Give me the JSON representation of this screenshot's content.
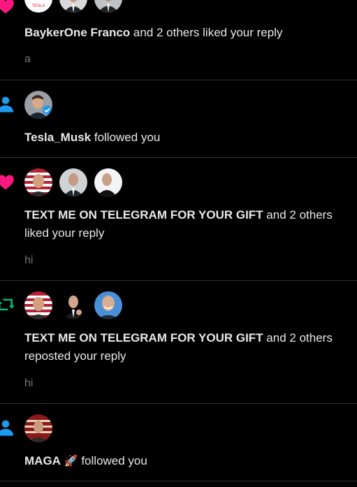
{
  "notifications": [
    {
      "type": "like",
      "icon": "heart-icon",
      "actor": "BaykerOne Franco",
      "message": " and 2 others liked your reply",
      "snippet": "a",
      "avatars": [
        "avatar-tesla-logo",
        "avatar-musk-suit",
        "avatar-musk-suit-2"
      ]
    },
    {
      "type": "follow",
      "icon": "person-icon",
      "actor": "Tesla_Musk",
      "message": " followed you",
      "avatars": [
        "avatar-musk-verified"
      ]
    },
    {
      "type": "like",
      "icon": "heart-icon",
      "actor": "TEXT ME ON TELEGRAM FOR YOUR GIFT",
      "message": " and 2 others liked your reply",
      "snippet": "hi",
      "avatars": [
        "avatar-flag-musk",
        "avatar-musk-suit",
        "avatar-musk-outdoor"
      ]
    },
    {
      "type": "repost",
      "icon": "repost-icon",
      "actor": "TEXT ME ON TELEGRAM FOR YOUR GIFT",
      "message": " and 2 others reposted your reply",
      "snippet": "hi",
      "avatars": [
        "avatar-flag-musk",
        "avatar-musk-gesture",
        "avatar-musk-smile"
      ]
    },
    {
      "type": "follow",
      "icon": "person-icon",
      "actor": "MAGA",
      "actor_emoji": "🚀",
      "message": " followed you",
      "avatars": [
        "avatar-maga-flag"
      ]
    }
  ],
  "colors": {
    "background": "#000000",
    "text": "#e7e9ea",
    "muted": "#71767b",
    "divider": "#2f3336",
    "like": "#f91880",
    "follow": "#1d9bf0",
    "repost": "#00ba7c"
  }
}
